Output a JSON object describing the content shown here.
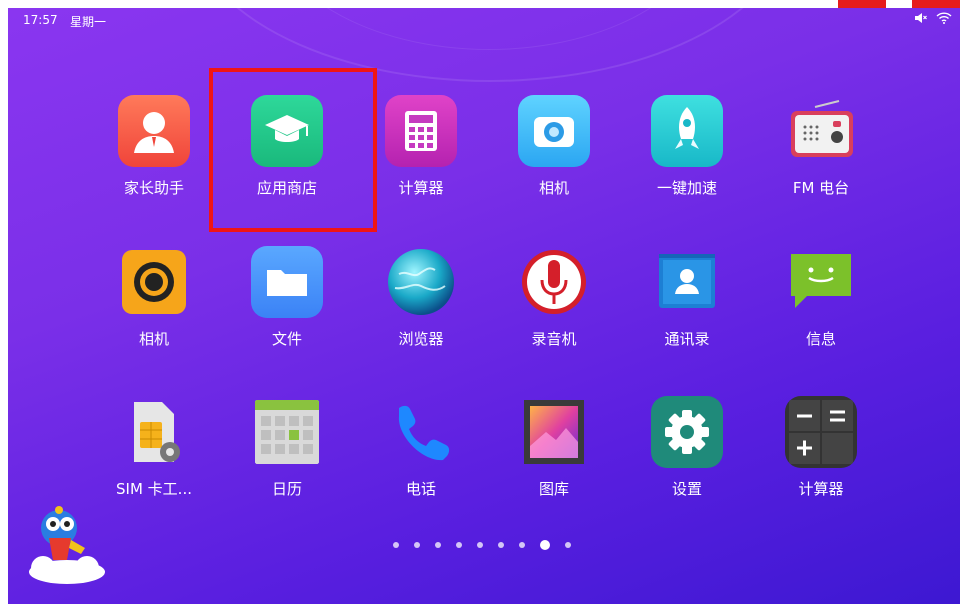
{
  "status": {
    "time": "17:57",
    "day": "星期一"
  },
  "apps": [
    {
      "label": "家长助手",
      "icon": "parent-assistant-icon"
    },
    {
      "label": "应用商店",
      "icon": "graduation-cap-icon"
    },
    {
      "label": "计算器",
      "icon": "calculator-icon"
    },
    {
      "label": "相机",
      "icon": "camera-icon"
    },
    {
      "label": "一键加速",
      "icon": "rocket-icon"
    },
    {
      "label": "FM 电台",
      "icon": "radio-icon"
    },
    {
      "label": "相机",
      "icon": "camera-aperture-icon"
    },
    {
      "label": "文件",
      "icon": "folder-icon"
    },
    {
      "label": "浏览器",
      "icon": "globe-icon"
    },
    {
      "label": "录音机",
      "icon": "microphone-icon"
    },
    {
      "label": "通讯录",
      "icon": "contacts-icon"
    },
    {
      "label": "信息",
      "icon": "message-icon"
    },
    {
      "label": "SIM 卡工...",
      "icon": "sim-card-icon"
    },
    {
      "label": "日历",
      "icon": "calendar-icon"
    },
    {
      "label": "电话",
      "icon": "phone-icon"
    },
    {
      "label": "图库",
      "icon": "gallery-icon"
    },
    {
      "label": "设置",
      "icon": "gear-icon"
    },
    {
      "label": "计算器",
      "icon": "calculator-dark-icon"
    }
  ],
  "pager": {
    "pages": 9,
    "current_index": 7
  },
  "colors": {
    "highlight": "#f01515",
    "background_top": "#8a36f0",
    "background_bottom": "#3d18d2"
  }
}
